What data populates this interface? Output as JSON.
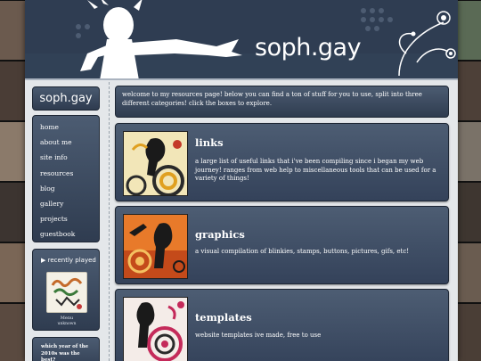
{
  "header": {
    "title": "soph.gay"
  },
  "sidebar": {
    "logo_text": "soph.gay",
    "nav": [
      {
        "label": "home"
      },
      {
        "label": "about me"
      },
      {
        "label": "site info"
      },
      {
        "label": "resources"
      },
      {
        "label": "blog"
      },
      {
        "label": "gallery"
      },
      {
        "label": "projects"
      },
      {
        "label": "guestbook"
      }
    ],
    "recently_played": {
      "title": "▶ recently played",
      "artist": "Menu",
      "song": "unknown"
    },
    "poll": {
      "question": "which year of the 2010s was the best?"
    }
  },
  "main": {
    "intro": "welcome to my resources page! below you can find a ton of stuff for you to use, split into three different categories! click the boxes to explore.",
    "cards": [
      {
        "title": "links",
        "description": "a large list of useful links that i've been compiling since i began my web journey! ranges from web help to miscellaneous tools that can be used for a variety of things!"
      },
      {
        "title": "graphics",
        "description": "a visual compilation of blinkies, stamps, buttons, pictures, gifs, etc!"
      },
      {
        "title": "templates",
        "description": "website templates ive made, free to use"
      }
    ]
  },
  "colors": {
    "panel_top": "#4c5c72",
    "panel_bottom": "#2f3c50",
    "page_bg": "#e4e7ea"
  }
}
